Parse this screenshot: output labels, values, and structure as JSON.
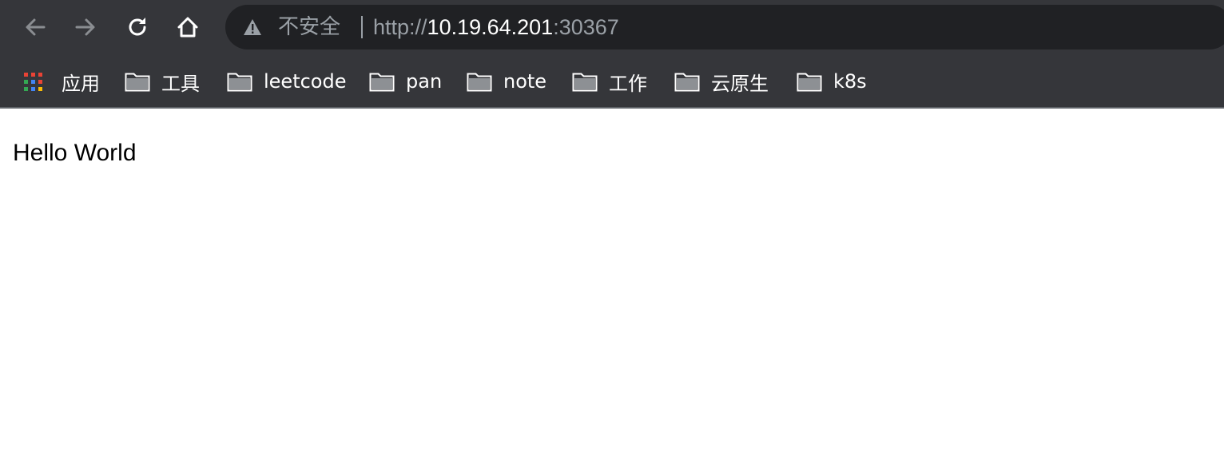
{
  "browser": {
    "nav": {
      "back_icon": "arrow-left-icon",
      "forward_icon": "arrow-right-icon",
      "reload_icon": "reload-icon",
      "home_icon": "home-icon"
    },
    "omnibox": {
      "warning_icon": "warning-triangle-icon",
      "security_label": "不安全",
      "url_scheme": "http://",
      "url_host": "10.19.64.201",
      "url_port": ":30367"
    },
    "bookmarks": [
      {
        "label": "应用",
        "icon": "apps-grid-icon"
      },
      {
        "label": "工具",
        "icon": "folder-icon"
      },
      {
        "label": "leetcode",
        "icon": "folder-icon"
      },
      {
        "label": "pan",
        "icon": "folder-icon"
      },
      {
        "label": "note",
        "icon": "folder-icon"
      },
      {
        "label": "工作",
        "icon": "folder-icon"
      },
      {
        "label": "云原生",
        "icon": "folder-icon"
      },
      {
        "label": "k8s",
        "icon": "folder-icon"
      }
    ]
  },
  "page": {
    "body_text": "Hello World"
  },
  "colors": {
    "toolbar_bg": "#35363a",
    "omnibox_bg": "#202124",
    "muted_text": "#9aa0a6",
    "page_bg": "#ffffff"
  }
}
